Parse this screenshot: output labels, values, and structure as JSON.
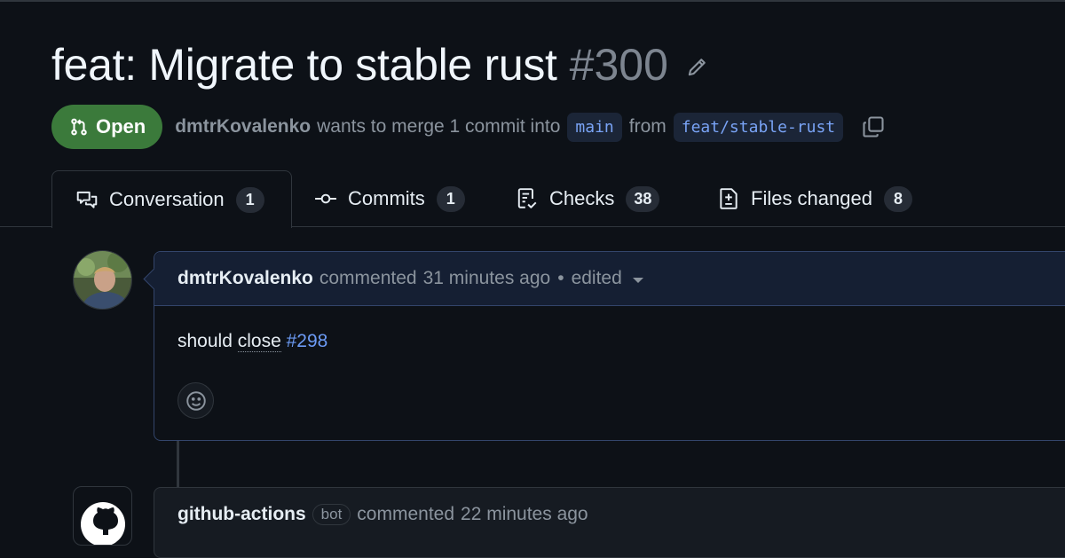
{
  "pr": {
    "title": "feat: Migrate to stable rust",
    "number": "#300",
    "state": "Open",
    "author": "dmtrKovalenko",
    "merge_text": "wants to merge 1 commit into",
    "base_branch": "main",
    "from_text": "from",
    "head_branch": "feat/stable-rust"
  },
  "tabs": [
    {
      "label": "Conversation",
      "count": "1",
      "icon": "comment-discussion-icon"
    },
    {
      "label": "Commits",
      "count": "1",
      "icon": "git-commit-icon"
    },
    {
      "label": "Checks",
      "count": "38",
      "icon": "checklist-icon"
    },
    {
      "label": "Files changed",
      "count": "8",
      "icon": "file-diff-icon"
    }
  ],
  "comment1": {
    "author": "dmtrKovalenko",
    "action": "commented",
    "time": "31 minutes ago",
    "separator": "•",
    "edited": "edited",
    "body_prefix": "should ",
    "body_keyword": "close",
    "body_link": "#298"
  },
  "comment2": {
    "author": "github-actions",
    "bot_label": "bot",
    "action": "commented",
    "time": "22 minutes ago"
  },
  "colors": {
    "background": "#0d1117",
    "open_badge": "#3b7a3b",
    "link": "#6c9bf5",
    "branch_bg": "#1b2537"
  }
}
